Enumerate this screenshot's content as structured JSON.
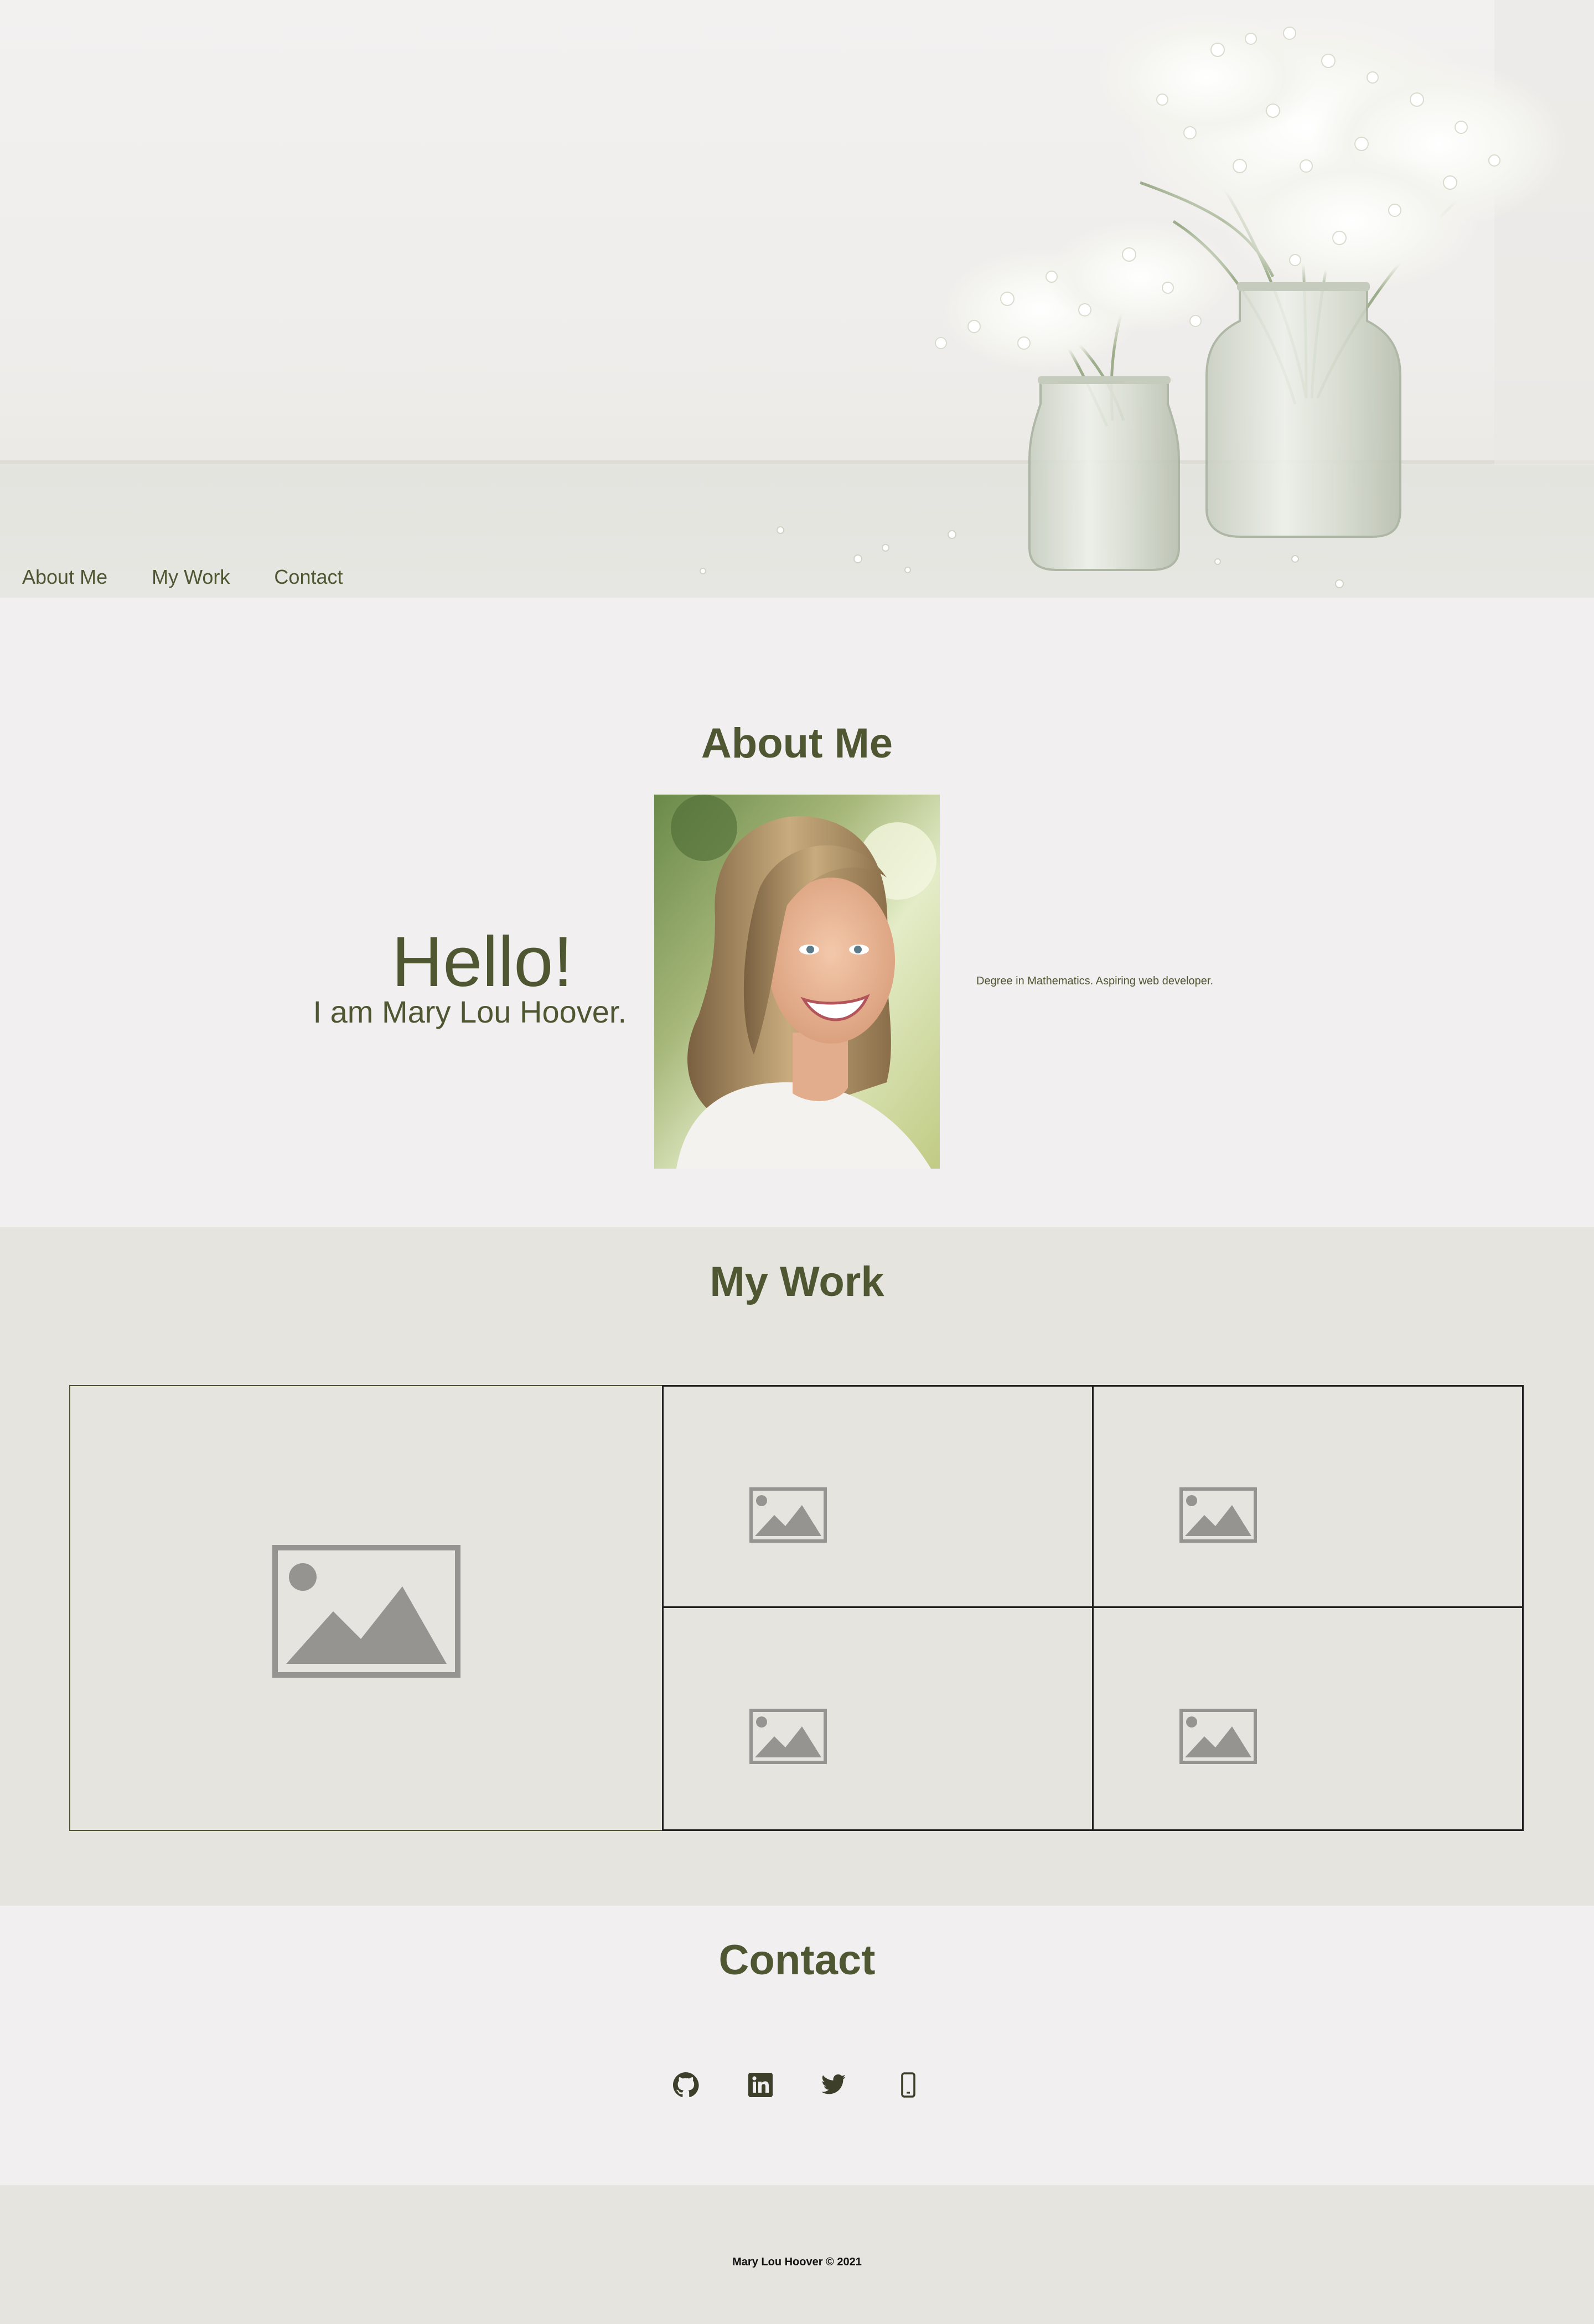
{
  "nav": {
    "items": [
      {
        "label": "About Me"
      },
      {
        "label": "My Work"
      },
      {
        "label": "Contact"
      }
    ]
  },
  "about": {
    "title": "About Me",
    "greeting": "Hello!",
    "intro": "I am Mary Lou Hoover.",
    "bio": "Degree in Mathematics. Aspiring web developer.",
    "portrait_icon": "portrait-photo"
  },
  "work": {
    "title": "My Work",
    "tiles": [
      {
        "icon": "image-placeholder-icon"
      },
      {
        "icon": "image-placeholder-icon"
      },
      {
        "icon": "image-placeholder-icon"
      },
      {
        "icon": "image-placeholder-icon"
      },
      {
        "icon": "image-placeholder-icon"
      }
    ]
  },
  "contact": {
    "title": "Contact",
    "links": [
      {
        "icon": "github-icon"
      },
      {
        "icon": "linkedin-icon"
      },
      {
        "icon": "twitter-icon"
      },
      {
        "icon": "phone-icon"
      }
    ]
  },
  "footer": {
    "copyright": "Mary Lou Hoover © 2021"
  },
  "colors": {
    "accent": "#4f5632",
    "background": "#f1eff0",
    "section_alt": "#e5e4df",
    "placeholder": "#959491"
  }
}
